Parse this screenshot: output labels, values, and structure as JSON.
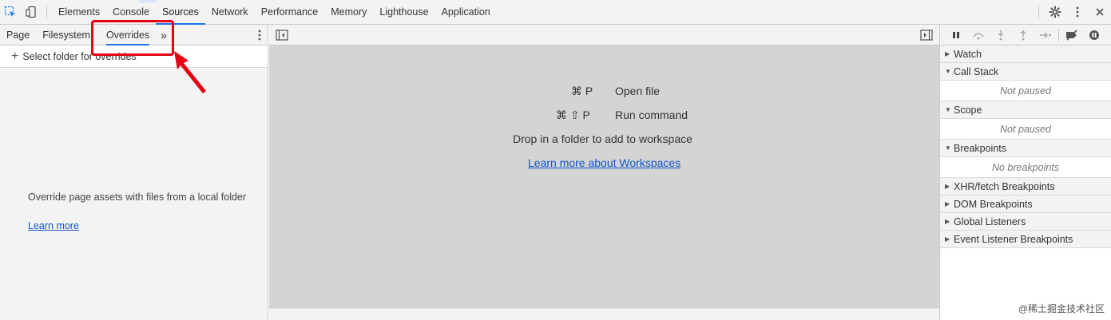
{
  "topbar": {
    "tabs": [
      {
        "label": "Elements"
      },
      {
        "label": "Console"
      },
      {
        "label": "Sources"
      },
      {
        "label": "Network"
      },
      {
        "label": "Performance"
      },
      {
        "label": "Memory"
      },
      {
        "label": "Lighthouse"
      },
      {
        "label": "Application"
      }
    ],
    "active_tab": "Sources",
    "left_icons": [
      "inspect-element-icon",
      "device-toggle-icon"
    ],
    "right_icons": [
      "gear-icon",
      "kebab-menu-icon",
      "close-icon"
    ]
  },
  "navigator": {
    "subtabs": [
      {
        "label": "Page"
      },
      {
        "label": "Filesystem"
      },
      {
        "label": "Overrides"
      }
    ],
    "more_label": "»",
    "active_subtab": "Overrides",
    "select_folder_label": "Select folder for overrides",
    "empty_text": "Override page assets with files from a local folder",
    "learn_more_label": "Learn more"
  },
  "editor": {
    "shortcuts": [
      {
        "keys": "⌘ P",
        "action": "Open file"
      },
      {
        "keys": "⌘ ⇧ P",
        "action": "Run command"
      }
    ],
    "drop_text": "Drop in a folder to add to workspace",
    "workspaces_link": "Learn more about Workspaces"
  },
  "debugger": {
    "sections": [
      {
        "title": "Watch",
        "expanded": false
      },
      {
        "title": "Call Stack",
        "expanded": true,
        "body": "Not paused"
      },
      {
        "title": "Scope",
        "expanded": true,
        "body": "Not paused"
      },
      {
        "title": "Breakpoints",
        "expanded": true,
        "body": "No breakpoints"
      },
      {
        "title": "XHR/fetch Breakpoints",
        "expanded": false
      },
      {
        "title": "DOM Breakpoints",
        "expanded": false
      },
      {
        "title": "Global Listeners",
        "expanded": false
      },
      {
        "title": "Event Listener Breakpoints",
        "expanded": false
      }
    ]
  },
  "watermark": "@稀土掘金技术社区",
  "colors": {
    "accent": "#1a73e8",
    "highlight": "#e60012",
    "link": "#1155cc",
    "editor_bg": "#d4d4d4",
    "panel_bg": "#f3f3f3"
  }
}
